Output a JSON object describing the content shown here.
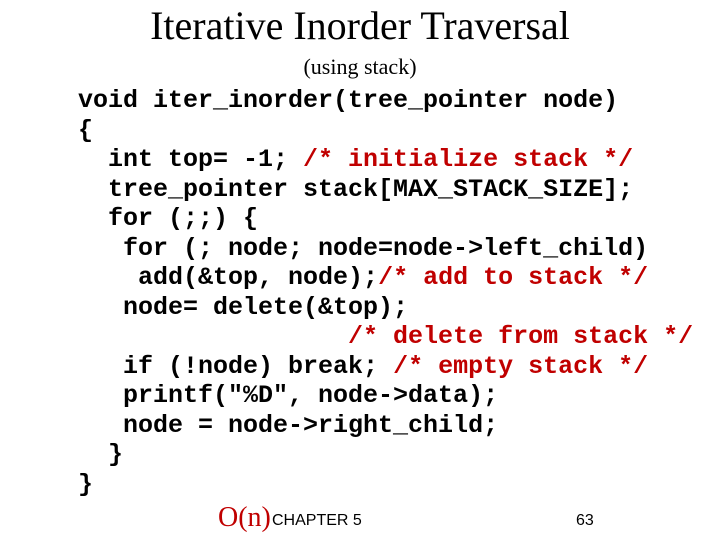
{
  "title": "Iterative Inorder Traversal",
  "subtitle": "(using stack)",
  "code": {
    "l1": "void iter_inorder(tree_pointer node)",
    "l2": "{",
    "l3a": "  int top= -1; ",
    "l3b": "/* initialize stack */",
    "l4": "  tree_pointer stack[MAX_STACK_SIZE];",
    "l5": "  for (;;) {",
    "l6": "   for (; node; node=node->left_child)",
    "l7a": "    add(&top, node);",
    "l7b": "/* add to stack */",
    "l8": "   node= delete(&top);",
    "l9a": "                  ",
    "l9b": "/* delete from stack */",
    "l10a": "   if (!node) break; ",
    "l10b": "/* empty stack */",
    "l11": "   printf(\"%D\", node->data);",
    "l12": "   node = node->right_child;",
    "l13": "  }",
    "l14": "}"
  },
  "complexity": "O(n)",
  "footer_chapter": "CHAPTER 5",
  "footer_page": "63"
}
